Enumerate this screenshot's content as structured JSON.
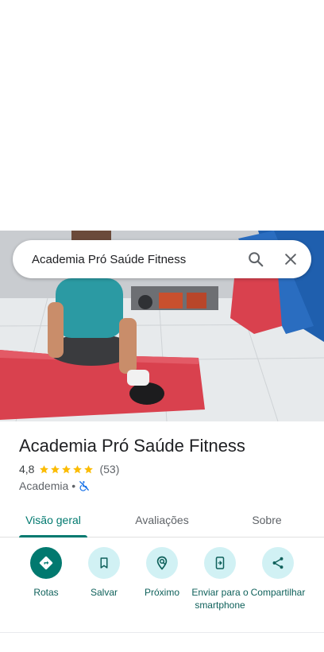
{
  "search": {
    "query": "Academia Pró Saúde Fitness",
    "icons": {
      "search": "search-icon",
      "close": "close-icon"
    }
  },
  "place": {
    "title": "Academia Pró Saúde Fitness",
    "rating_value": "4,8",
    "rating_stars": 5,
    "review_count": "(53)",
    "category": "Academia",
    "separator": "•",
    "accessibility_icon": "no-wheelchair-icon"
  },
  "tabs": [
    {
      "label": "Visão geral",
      "active": true
    },
    {
      "label": "Avaliações",
      "active": false
    },
    {
      "label": "Sobre",
      "active": false
    }
  ],
  "actions": [
    {
      "label": "Rotas",
      "icon": "directions-icon"
    },
    {
      "label": "Salvar",
      "icon": "bookmark-icon"
    },
    {
      "label": "Próximo",
      "icon": "nearby-icon"
    },
    {
      "label": "Enviar para o smartphone",
      "icon": "send-to-phone-icon"
    },
    {
      "label": "Compartilhar",
      "icon": "share-icon"
    }
  ],
  "colors": {
    "accent": "#01796f",
    "action_bg": "#d1f1f4",
    "star": "#fbbc04",
    "mat_red": "#d9414e",
    "mat_blue": "#1f5fae"
  }
}
